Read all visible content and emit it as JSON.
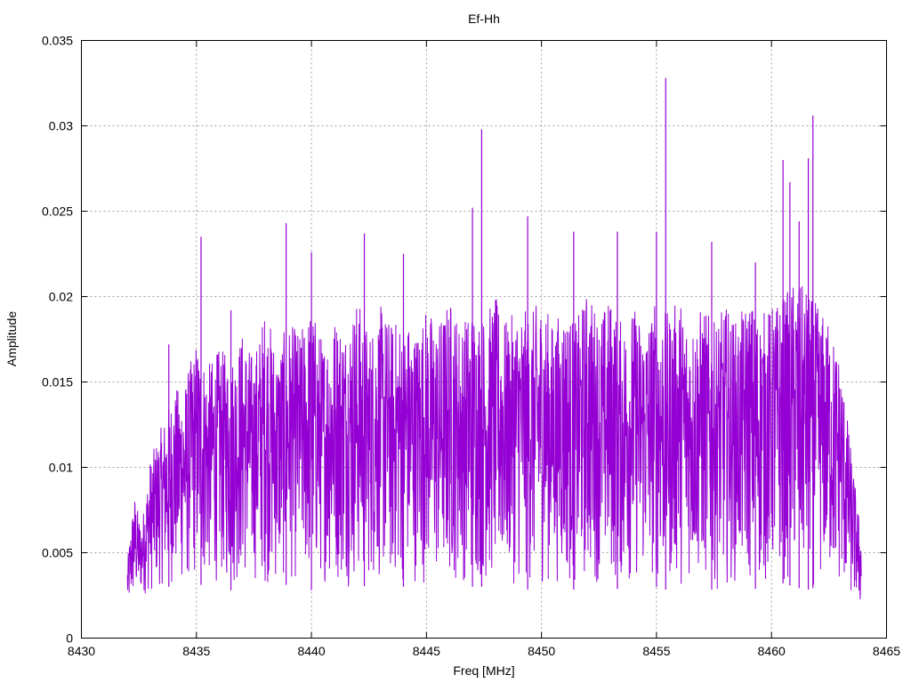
{
  "chart_data": {
    "type": "line",
    "title": "Ef-Hh",
    "xlabel": "Freq [MHz]",
    "ylabel": "Amplitude",
    "xlim": [
      8430,
      8465
    ],
    "ylim": [
      0,
      0.035
    ],
    "x_ticks": [
      "8430",
      "8435",
      "8440",
      "8445",
      "8450",
      "8455",
      "8460",
      "8465"
    ],
    "y_ticks": [
      "0",
      "0.005",
      "0.01",
      "0.015",
      "0.02",
      "0.025",
      "0.03",
      "0.035"
    ],
    "grid": true,
    "series": [
      {
        "color": "#9400d3",
        "x": [
          8432.0,
          8432.3,
          8432.6,
          8433.0,
          8433.5,
          8434.0,
          8434.5,
          8435.0,
          8435.5,
          8436.0,
          8436.5,
          8437.0,
          8437.5,
          8438.0,
          8438.5,
          8439.0,
          8439.5,
          8440.0,
          8440.5,
          8441.0,
          8441.5,
          8442.0,
          8442.5,
          8443.0,
          8443.5,
          8444.0,
          8444.5,
          8445.0,
          8445.5,
          8446.0,
          8446.5,
          8447.0,
          8447.5,
          8448.0,
          8448.5,
          8449.0,
          8449.5,
          8450.0,
          8450.5,
          8451.0,
          8451.5,
          8452.0,
          8452.5,
          8453.0,
          8453.5,
          8454.0,
          8454.5,
          8455.0,
          8455.5,
          8456.0,
          8456.5,
          8457.0,
          8457.5,
          8458.0,
          8458.5,
          8459.0,
          8459.5,
          8460.0,
          8460.5,
          8461.0,
          8461.5,
          8462.0,
          8462.5,
          8463.0,
          8463.5,
          8463.9
        ],
        "upper": [
          0.0045,
          0.0085,
          0.0065,
          0.0105,
          0.0125,
          0.0145,
          0.015,
          0.0175,
          0.016,
          0.017,
          0.0165,
          0.018,
          0.0165,
          0.0195,
          0.017,
          0.0185,
          0.018,
          0.0195,
          0.0175,
          0.019,
          0.0185,
          0.02,
          0.018,
          0.0195,
          0.0185,
          0.019,
          0.018,
          0.0195,
          0.0185,
          0.02,
          0.0185,
          0.0195,
          0.019,
          0.02,
          0.0185,
          0.0195,
          0.019,
          0.02,
          0.0185,
          0.0195,
          0.0185,
          0.0205,
          0.019,
          0.02,
          0.0185,
          0.0195,
          0.0185,
          0.02,
          0.019,
          0.02,
          0.0185,
          0.0195,
          0.0185,
          0.0195,
          0.0185,
          0.02,
          0.019,
          0.0195,
          0.02,
          0.021,
          0.0205,
          0.0195,
          0.0185,
          0.0165,
          0.0105,
          0.006
        ],
        "lower": [
          0.0015,
          0.002,
          0.0025,
          0.0025,
          0.003,
          0.003,
          0.0028,
          0.0032,
          0.003,
          0.0032,
          0.0028,
          0.003,
          0.0032,
          0.003,
          0.0028,
          0.0032,
          0.003,
          0.0028,
          0.0032,
          0.003,
          0.003,
          0.0028,
          0.0032,
          0.003,
          0.0028,
          0.003,
          0.0032,
          0.003,
          0.0028,
          0.003,
          0.0032,
          0.003,
          0.003,
          0.0028,
          0.0032,
          0.003,
          0.0028,
          0.003,
          0.0032,
          0.003,
          0.0028,
          0.003,
          0.0032,
          0.003,
          0.0028,
          0.003,
          0.0032,
          0.003,
          0.0028,
          0.003,
          0.0032,
          0.003,
          0.0028,
          0.003,
          0.0032,
          0.003,
          0.0028,
          0.003,
          0.0032,
          0.003,
          0.0028,
          0.003,
          0.003,
          0.0025,
          0.002,
          0.0015
        ],
        "peaks": [
          {
            "x": 8433.8,
            "y": 0.0172
          },
          {
            "x": 8435.2,
            "y": 0.0235
          },
          {
            "x": 8436.5,
            "y": 0.0192
          },
          {
            "x": 8438.9,
            "y": 0.0243
          },
          {
            "x": 8440.0,
            "y": 0.0226
          },
          {
            "x": 8442.3,
            "y": 0.0237
          },
          {
            "x": 8444.0,
            "y": 0.0225
          },
          {
            "x": 8447.0,
            "y": 0.0252
          },
          {
            "x": 8447.4,
            "y": 0.0298
          },
          {
            "x": 8449.4,
            "y": 0.0247
          },
          {
            "x": 8451.4,
            "y": 0.0238
          },
          {
            "x": 8453.3,
            "y": 0.0238
          },
          {
            "x": 8455.0,
            "y": 0.0238
          },
          {
            "x": 8455.4,
            "y": 0.0328
          },
          {
            "x": 8457.4,
            "y": 0.0232
          },
          {
            "x": 8460.5,
            "y": 0.028
          },
          {
            "x": 8460.8,
            "y": 0.0267
          },
          {
            "x": 8461.6,
            "y": 0.0281
          },
          {
            "x": 8461.8,
            "y": 0.0306
          },
          {
            "x": 8461.2,
            "y": 0.0244
          },
          {
            "x": 8459.3,
            "y": 0.022
          }
        ]
      }
    ]
  }
}
